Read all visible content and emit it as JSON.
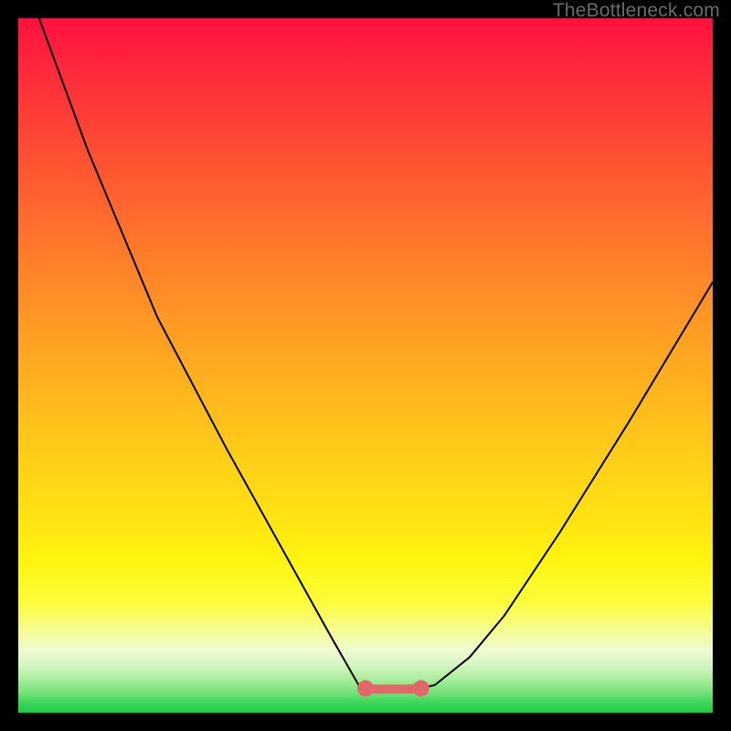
{
  "watermark": "TheBottleneck.com",
  "colors": {
    "frame_bg": "#000000",
    "curve_stroke": "#000000",
    "marker_fill": "#e16868",
    "marker_stroke": "#e16868"
  },
  "chart_data": {
    "type": "line",
    "title": "",
    "xlabel": "",
    "ylabel": "",
    "xlim": [
      0,
      100
    ],
    "ylim": [
      0,
      100
    ],
    "grid": false,
    "legend": false,
    "series": [
      {
        "name": "bottleneck-curve",
        "x": [
          3,
          10,
          20,
          30,
          40,
          45,
          49,
          50,
          51,
          53,
          56,
          58,
          60,
          65,
          70,
          78,
          88,
          100
        ],
        "y": [
          100,
          81,
          57,
          38,
          20,
          11,
          4,
          3.5,
          3.4,
          3.4,
          3.4,
          3.5,
          4,
          8,
          14,
          26,
          42,
          62
        ]
      }
    ],
    "markers": {
      "name": "optimal-range",
      "style": "dots-with-connector",
      "x": [
        50,
        51,
        53,
        54.5,
        56,
        58
      ],
      "y": [
        3.5,
        3.4,
        3.4,
        3.4,
        3.4,
        3.5
      ]
    }
  }
}
